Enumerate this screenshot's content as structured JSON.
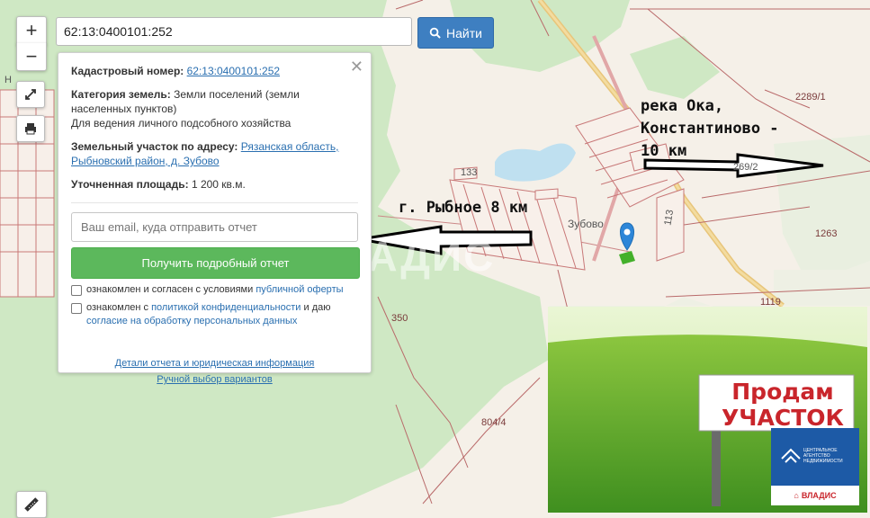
{
  "search": {
    "value": "62:13:0400101:252",
    "button_label": "Найти"
  },
  "controls": {
    "zoom_in": "+",
    "zoom_out": "−"
  },
  "panel": {
    "cadastral_label": "Кадастровый номер:",
    "cadastral_value": "62:13:0400101:252",
    "category_label": "Категория земель:",
    "category_value": "Земли поселений (земли населенных пунктов)",
    "usage": "Для ведения личного подсобного хозяйства",
    "address_label": "Земельный участок по адресу:",
    "address_value": "Рязанская область, Рыбновский район, д. Зубово",
    "area_label": "Уточненная площадь:",
    "area_value": "1 200 кв.м.",
    "email_placeholder": "Ваш email, куда отправить отчет",
    "report_button": "Получить подробный отчет",
    "agree1_text": "ознакомлен и согласен с условиями",
    "agree1_link": "публичной оферты",
    "agree2_text": "ознакомлен с",
    "agree2_link": "политикой конфиденциальности",
    "agree2_tail": "и даю",
    "agree2_link2": "согласие на обработку персональных данных",
    "details_link": "Детали отчета и юридическая информация",
    "manual_link": "Ручной выбор вариантов"
  },
  "map_labels": {
    "village": "Зубово",
    "n2289": "2289/1",
    "n1263": "1263",
    "n1119": "1119",
    "n350": "350",
    "n804": "804/4",
    "n133": "133",
    "n113": "113",
    "n269": "269/2",
    "left_fragment": "Н"
  },
  "annotations": {
    "oka": [
      "река Ока,",
      "Константиново -",
      "10 км"
    ],
    "rybnoe": "г. Рыбное 8 км"
  },
  "watermark": "ВЛАДИС",
  "photo": {
    "sign_line1": "Продам",
    "sign_line2": "УЧАСТОК",
    "agency_line1": "ЦЕНТРАЛЬНОЕ",
    "agency_line2": "АГЕНТСТВО",
    "agency_line3": "НЕДВИЖИМОСТИ",
    "agency_bottom": "ВЛАДИС"
  }
}
